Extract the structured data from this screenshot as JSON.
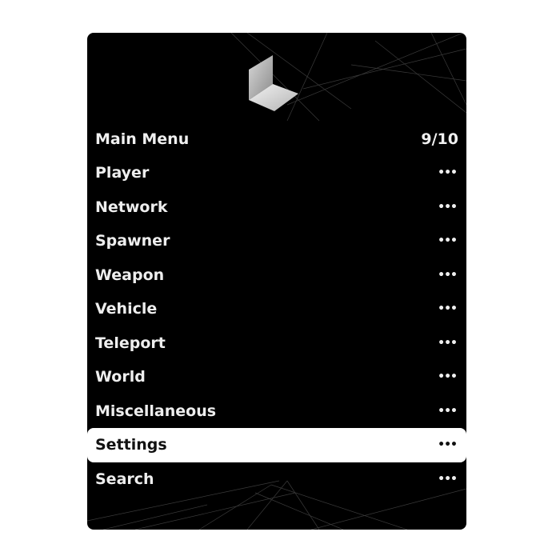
{
  "menu": {
    "title": "Main Menu",
    "page_indicator": "9/10",
    "items": [
      {
        "label": "Player",
        "icon": "more-dots"
      },
      {
        "label": "Network",
        "icon": "more-dots"
      },
      {
        "label": "Spawner",
        "icon": "more-dots"
      },
      {
        "label": "Weapon",
        "icon": "more-dots"
      },
      {
        "label": "Vehicle",
        "icon": "more-dots"
      },
      {
        "label": "Teleport",
        "icon": "more-dots"
      },
      {
        "label": "World",
        "icon": "more-dots"
      },
      {
        "label": "Miscellaneous",
        "icon": "more-dots"
      },
      {
        "label": "Settings",
        "icon": "more-dots",
        "selected": true
      },
      {
        "label": "Search",
        "icon": "more-dots"
      }
    ],
    "more_glyph": "•••"
  },
  "colors": {
    "background": "#000000",
    "text": "#eeeeee",
    "selected_background": "#ffffff",
    "selected_text": "#111111"
  }
}
